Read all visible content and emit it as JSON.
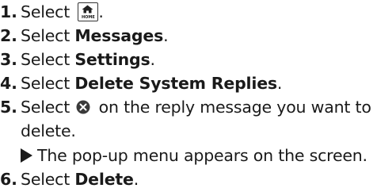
{
  "steps": [
    {
      "num": "1.",
      "pre": "Select ",
      "icon": "home-button-icon",
      "icon_caption": "HOME",
      "post": "."
    },
    {
      "num": "2.",
      "pre": "Select ",
      "bold": "Messages",
      "post": "."
    },
    {
      "num": "3.",
      "pre": "Select ",
      "bold": "Settings",
      "post": "."
    },
    {
      "num": "4.",
      "pre": "Select ",
      "bold": "Delete System Replies",
      "post": "."
    },
    {
      "num": "5.",
      "pre": "Select ",
      "icon": "delete-circle-icon",
      "post": " on the reply message you want to",
      "continuation": "delete."
    },
    {
      "num": "6.",
      "pre": "Select ",
      "bold": "Delete",
      "post": "."
    }
  ],
  "result_note": "The pop-up menu appears on the screen."
}
